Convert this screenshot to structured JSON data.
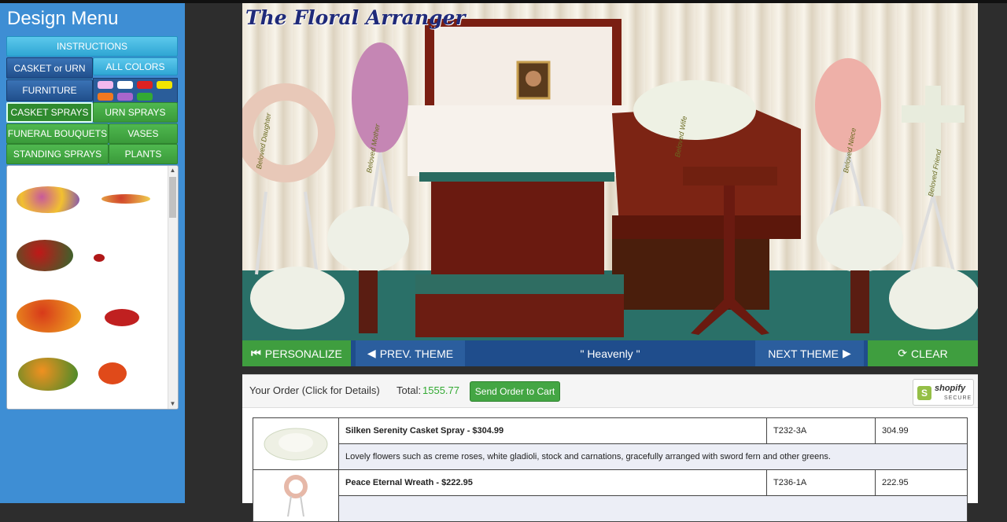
{
  "sidebar": {
    "title": "Design Menu",
    "buttons": {
      "instructions": "INSTRUCTIONS",
      "casket_or_urn": "CASKET or URN",
      "all_colors": "ALL COLORS",
      "furniture": "FURNITURE",
      "casket_sprays": "CASKET SPRAYS",
      "urn_sprays": "URN SPRAYS",
      "funeral_bouquets": "FUNERAL BOUQUETS",
      "vases": "VASES",
      "standing_sprays": "STANDING SPRAYS",
      "plants": "PLANTS"
    },
    "color_swatches": [
      "#f0b8ee",
      "#ffffff",
      "#dd2222",
      "#f2e600",
      "#f07820",
      "#aa66cc",
      "#33aa33"
    ],
    "flower_thumbs": [
      {
        "name": "mixed-casket-spray",
        "colors": [
          "#c85a9a",
          "#f2c030",
          "#7a4bbd"
        ]
      },
      {
        "name": "long-casket-spray",
        "colors": [
          "#d0402a",
          "#f0d050"
        ]
      },
      {
        "name": "red-rose-casket-spray",
        "colors": [
          "#c01818",
          "#2e6b2e"
        ]
      },
      {
        "name": "heart-spray",
        "colors": [
          "#b01818"
        ]
      },
      {
        "name": "red-orange-casket-spray",
        "colors": [
          "#d83a1a",
          "#f0b020"
        ]
      },
      {
        "name": "small-red-spray",
        "colors": [
          "#c02020"
        ]
      },
      {
        "name": "tropical-spray",
        "colors": [
          "#f09020",
          "#3a8a2a"
        ]
      },
      {
        "name": "small-tropical-spray",
        "colors": [
          "#e04a1a"
        ]
      }
    ]
  },
  "scene": {
    "title": "The Floral Arranger",
    "ribbons": [
      "Beloved Daughter",
      "Beloved Mother",
      "Beloved Wife",
      "Beloved Niece",
      "Beloved Friend"
    ]
  },
  "nav": {
    "personalize": "PERSONALIZE",
    "prev_theme": "PREV. THEME",
    "theme_name": "\" Heavenly \"",
    "next_theme": "NEXT THEME",
    "clear": "CLEAR"
  },
  "order": {
    "label": "Your Order (Click for Details)",
    "total_label": "Total:",
    "total_value": "1555.77",
    "send_button": "Send Order to Cart",
    "shopify_name": "shopify",
    "shopify_secure": "SECURE",
    "items": [
      {
        "name": "Silken Serenity Casket Spray - $304.99",
        "code": "T232-3A",
        "price": "304.99",
        "description": "Lovely flowers such as creme roses, white gladioli, stock and carnations, gracefully arranged with sword fern and other greens."
      },
      {
        "name": "Peace Eternal Wreath - $222.95",
        "code": "T236-1A",
        "price": "222.95",
        "description": ""
      }
    ]
  }
}
